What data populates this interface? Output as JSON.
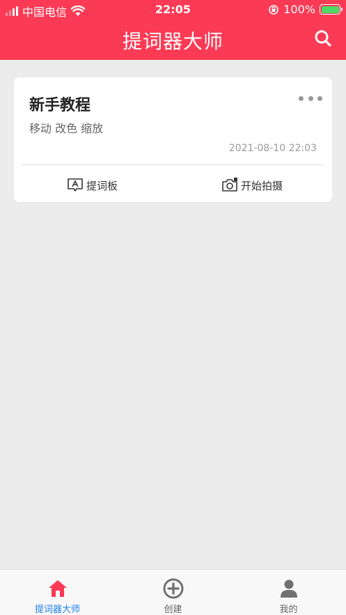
{
  "status": {
    "carrier": "中国电信",
    "time": "22:05",
    "battery": "100%"
  },
  "header": {
    "title": "提词器大师"
  },
  "card": {
    "title": "新手教程",
    "description": "移动 改色 缩放",
    "timestamp": "2021-08-10 22:03",
    "action_left": "提词板",
    "action_right": "开始拍摄"
  },
  "tabs": [
    {
      "label": "提词器大师",
      "icon": "home-icon"
    },
    {
      "label": "创建",
      "icon": "plus-circle-icon"
    },
    {
      "label": "我的",
      "icon": "person-icon"
    }
  ],
  "colors": {
    "brand": "#fb3a55",
    "active_tab_text": "#1a7fe8",
    "inactive_icon": "#707070"
  }
}
